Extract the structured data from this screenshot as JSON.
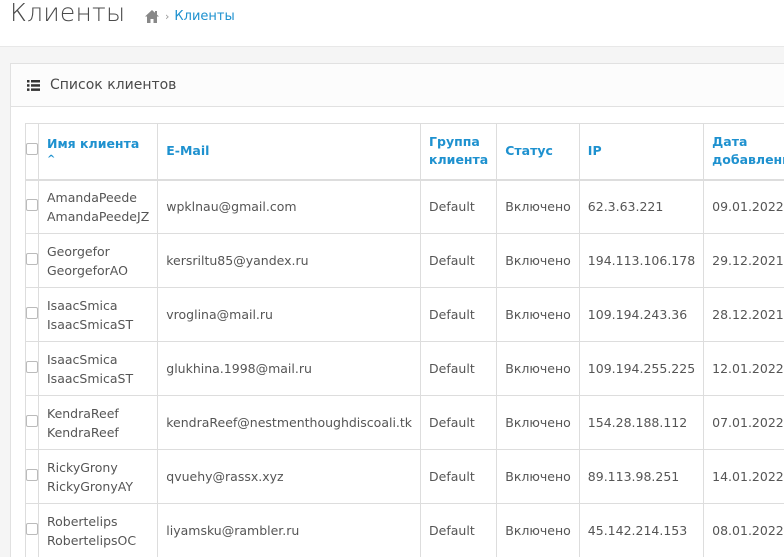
{
  "header": {
    "title": "Клиенты",
    "breadcrumb": {
      "current": "Клиенты"
    }
  },
  "panel": {
    "title": "Список клиентов"
  },
  "table": {
    "columns": {
      "name": "Имя клиента",
      "email": "E-Mail",
      "group_line1": "Группа",
      "group_line2": "клиента",
      "status": "Статус",
      "ip": "IP",
      "date_line1": "Дата",
      "date_line2": "добавления"
    },
    "sort_indicator": "^",
    "rows": [
      {
        "name1": "AmandaPeede",
        "name2": "AmandaPeedeJZ",
        "email": "wpklnau@gmail.com",
        "group": "Default",
        "status": "Включено",
        "ip": "62.3.63.221",
        "date": "09.01.2022"
      },
      {
        "name1": "Georgefor",
        "name2": "GeorgeforAO",
        "email": "kersriltu85@yandex.ru",
        "group": "Default",
        "status": "Включено",
        "ip": "194.113.106.178",
        "date": "29.12.2021"
      },
      {
        "name1": "IsaacSmica",
        "name2": "IsaacSmicaST",
        "email": "vroglina@mail.ru",
        "group": "Default",
        "status": "Включено",
        "ip": "109.194.243.36",
        "date": "28.12.2021"
      },
      {
        "name1": "IsaacSmica",
        "name2": "IsaacSmicaST",
        "email": "glukhina.1998@mail.ru",
        "group": "Default",
        "status": "Включено",
        "ip": "109.194.255.225",
        "date": "12.01.2022"
      },
      {
        "name1": "KendraReef",
        "name2": "KendraReef",
        "email": "kendraReef@nestmenthoughdiscoali.tk",
        "group": "Default",
        "status": "Включено",
        "ip": "154.28.188.112",
        "date": "07.01.2022"
      },
      {
        "name1": "RickyGrony",
        "name2": "RickyGronyAY",
        "email": "qvuehy@rassx.xyz",
        "group": "Default",
        "status": "Включено",
        "ip": "89.113.98.251",
        "date": "14.01.2022"
      },
      {
        "name1": "Robertelips",
        "name2": "RobertelipsOC",
        "email": "liyamsku@rambler.ru",
        "group": "Default",
        "status": "Включено",
        "ip": "45.142.214.153",
        "date": "08.01.2022"
      }
    ]
  },
  "colors": {
    "accent": "#1e91cf",
    "text": "#555555",
    "border": "#dddddd"
  },
  "icons": {
    "home": "home-icon",
    "list": "list-icon"
  }
}
